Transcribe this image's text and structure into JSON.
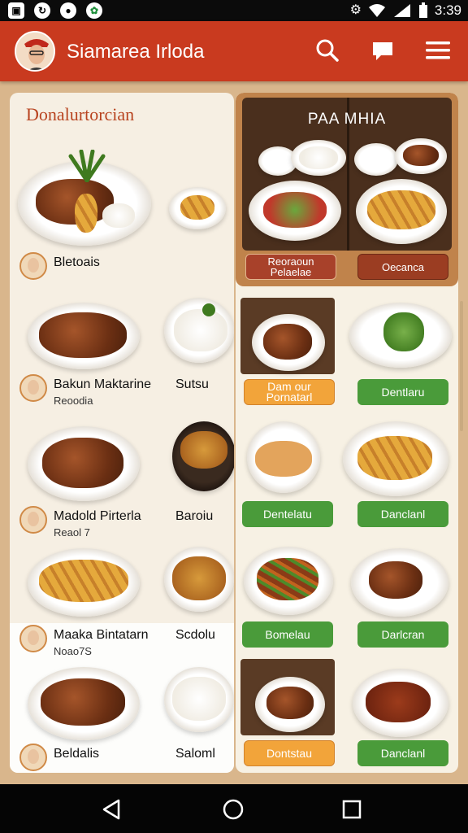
{
  "status_bar": {
    "time": "3:39",
    "icons": [
      "image-icon",
      "share-icon",
      "circle-app-icon",
      "green-app-icon",
      "settings-icon",
      "wifi-icon",
      "signal-icon",
      "battery-icon"
    ]
  },
  "app_bar": {
    "title": "Siamarea Irloda",
    "color": "#c93a1f",
    "actions": [
      "search-icon",
      "chat-icon",
      "menu-icon"
    ]
  },
  "left_panel": {
    "title": "Donalurtorcian",
    "items": [
      {
        "name": "Bletoais",
        "sub": "",
        "side": ""
      },
      {
        "name": "Bakun Maktarine",
        "sub": "Reoodia",
        "side": "Sutsu"
      },
      {
        "name": "Madold Pirterla",
        "sub": "Reaol 7",
        "side": "Baroiu"
      },
      {
        "name": "Maaka Bintatarn",
        "sub": "Noao7S",
        "side": "Scdolu"
      },
      {
        "name": "Beldalis",
        "sub": "",
        "side": "Saloml"
      }
    ]
  },
  "right_panel": {
    "feature": {
      "title": "PAA MHIA",
      "left_button": "Reoraoun Pelaelae",
      "right_button": "Oecanca"
    },
    "grid_buttons": [
      {
        "label": "Dam our Pornatarl",
        "style": "orange"
      },
      {
        "label": "Dentlaru",
        "style": "green"
      },
      {
        "label": "Dentelatu",
        "style": "green"
      },
      {
        "label": "Danclanl",
        "style": "green"
      },
      {
        "label": "Bomelau",
        "style": "green"
      },
      {
        "label": "Darlcran",
        "style": "green"
      },
      {
        "label": "Dontstau",
        "style": "orange"
      },
      {
        "label": "Danclanl",
        "style": "green"
      }
    ]
  },
  "nav_bar": {
    "icons": [
      "back-icon",
      "home-icon",
      "recents-icon"
    ]
  },
  "colors": {
    "accent": "#c93a1f",
    "green_button": "#4a9b3a",
    "orange_button": "#f2a43a",
    "panel_bg": "#f6efe3"
  }
}
